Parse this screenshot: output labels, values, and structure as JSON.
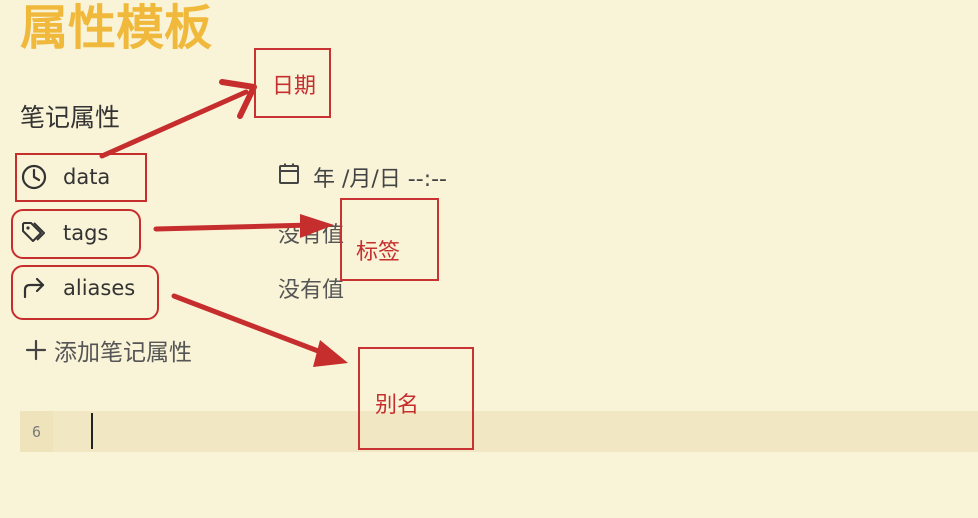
{
  "page": {
    "title": "属性模板",
    "section_heading": "笔记属性",
    "add_property_label": "添加笔记属性"
  },
  "properties": [
    {
      "name": "data",
      "icon": "clock-icon",
      "value": "年 /月/日 --:--",
      "value_type": "date"
    },
    {
      "name": "tags",
      "icon": "tag-icon",
      "value": "没有值",
      "value_type": "empty"
    },
    {
      "name": "aliases",
      "icon": "forward-arrow-icon",
      "value": "没有值",
      "value_type": "empty"
    }
  ],
  "editor": {
    "line_number": "6"
  },
  "annotations": {
    "date_label": "日期",
    "tags_label": "标签",
    "aliases_label": "别名",
    "color": "#c83232"
  },
  "colors": {
    "background": "#f9f3d7",
    "title": "#f0b93c",
    "editor_line": "#f2e7c3"
  }
}
